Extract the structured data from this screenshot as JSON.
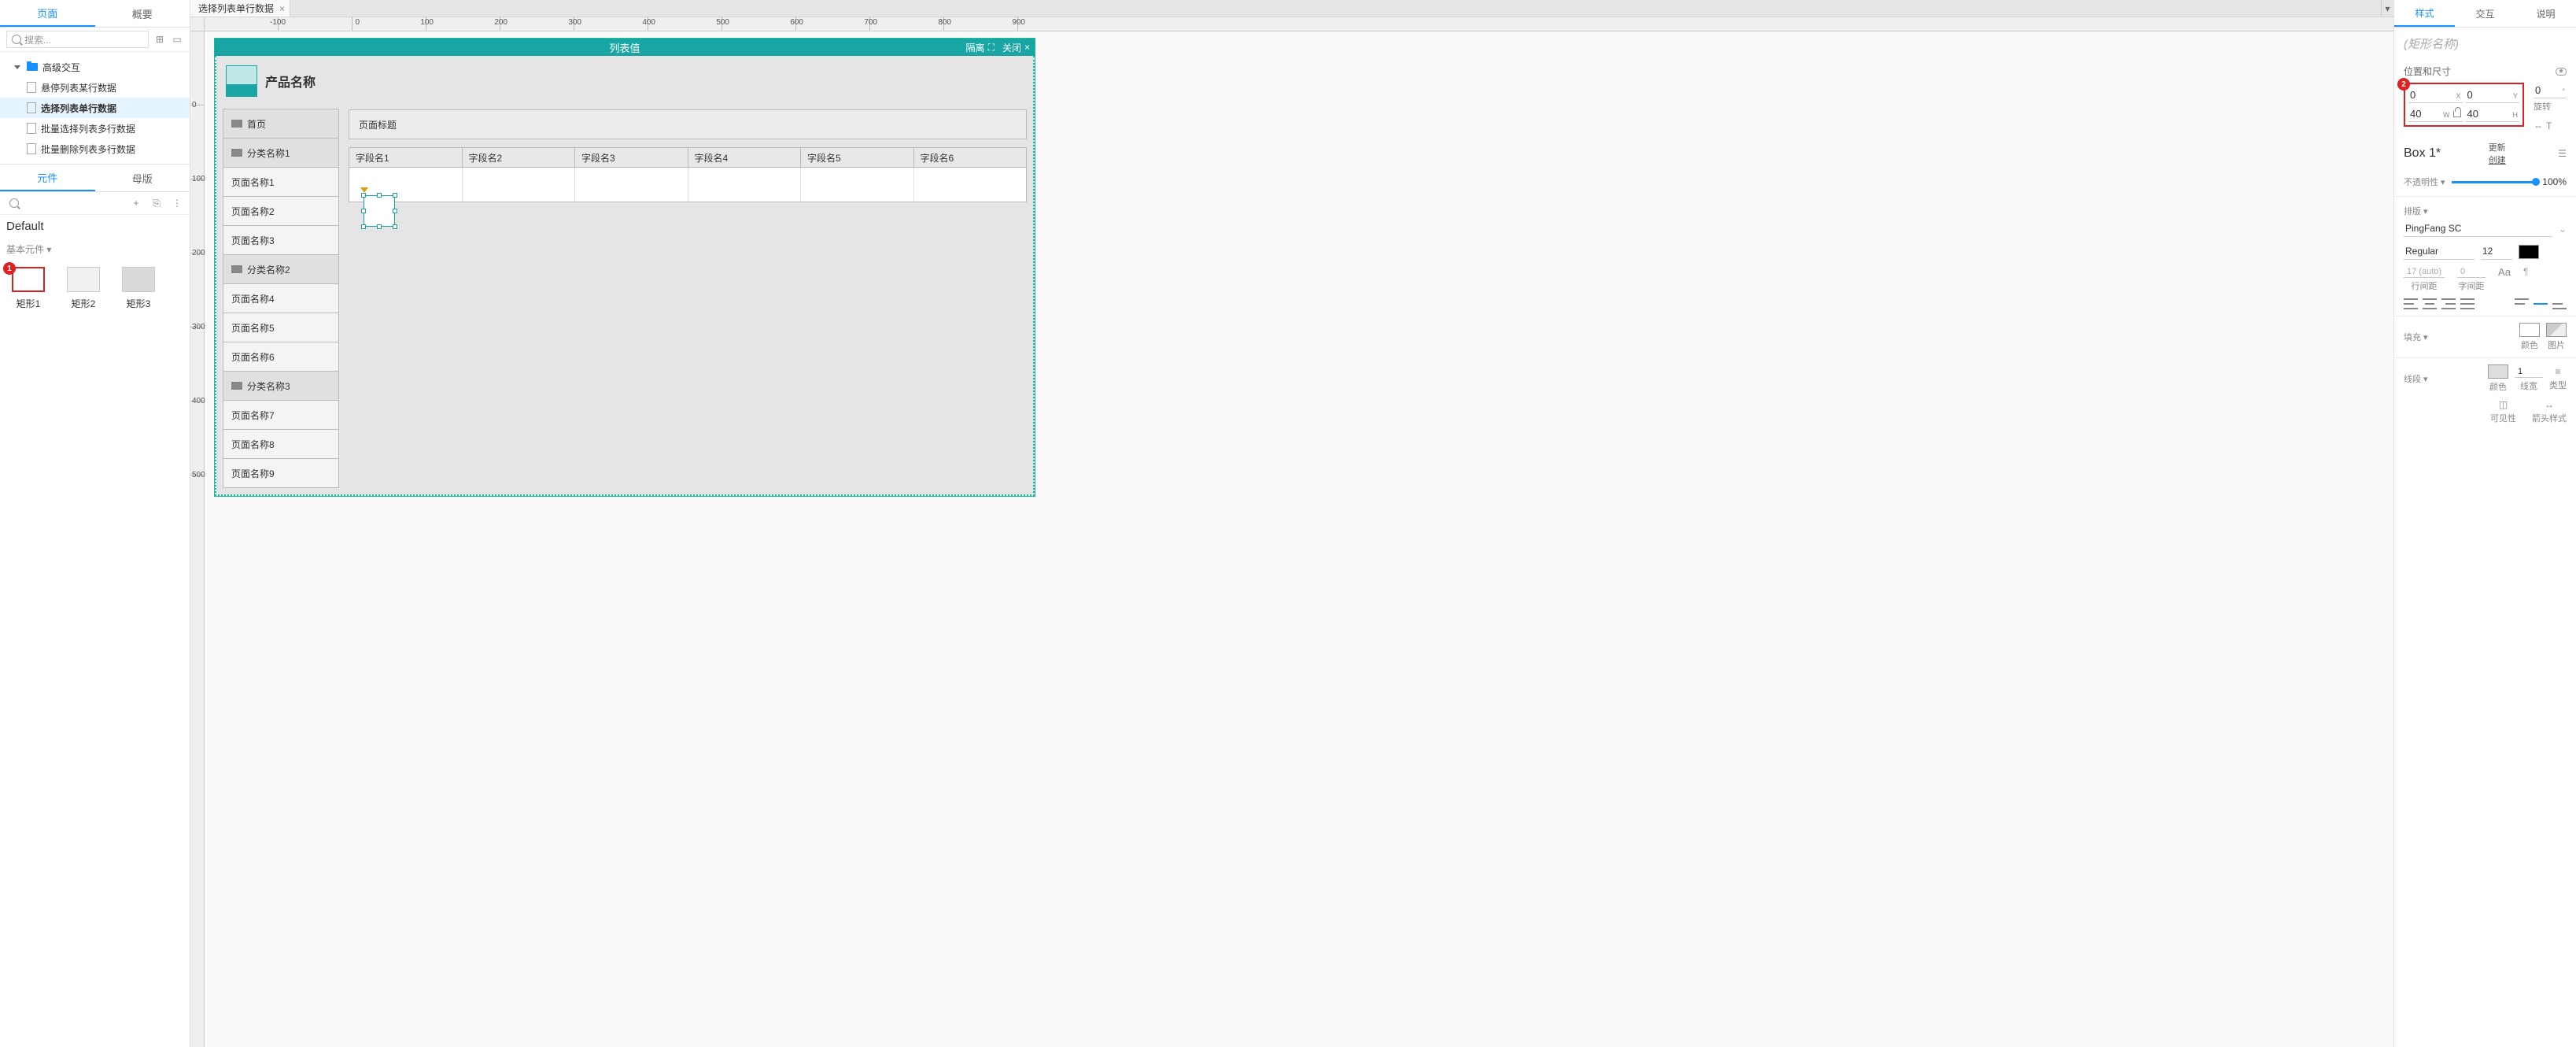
{
  "left": {
    "tabs": {
      "page": "页面",
      "outline": "概要"
    },
    "search_placeholder": "搜索...",
    "tree": {
      "folder": "高级交互",
      "pages": [
        "悬停列表某行数据",
        "选择列表单行数据",
        "批量选择列表多行数据",
        "批量删除列表多行数据"
      ],
      "active_index": 1
    },
    "lib_tabs": {
      "widgets": "元件",
      "masters": "母版"
    },
    "lib_name": "Default",
    "lib_section": "基本元件 ▾",
    "shapes": [
      "矩形1",
      "矩形2",
      "矩形3"
    ]
  },
  "tabbar": {
    "file_tab": "选择列表单行数据"
  },
  "ruler_h": [
    "-100",
    "0",
    "100",
    "200",
    "300",
    "400",
    "500",
    "600",
    "700",
    "800",
    "900"
  ],
  "ruler_v": [
    "0",
    "100",
    "200",
    "300",
    "400",
    "500"
  ],
  "artboard": {
    "title": "列表值",
    "isolate": "隔离",
    "close": "关闭",
    "product_name": "产品名称",
    "nav": [
      {
        "label": "首页",
        "cat": true
      },
      {
        "label": "分类名称1",
        "cat": true
      },
      {
        "label": "页面名称1"
      },
      {
        "label": "页面名称2"
      },
      {
        "label": "页面名称3"
      },
      {
        "label": "分类名称2",
        "cat": true
      },
      {
        "label": "页面名称4"
      },
      {
        "label": "页面名称5"
      },
      {
        "label": "页面名称6"
      },
      {
        "label": "分类名称3",
        "cat": true
      },
      {
        "label": "页面名称7"
      },
      {
        "label": "页面名称8"
      },
      {
        "label": "页面名称9"
      }
    ],
    "page_title": "页面标题",
    "columns": [
      "字段名1",
      "字段名2",
      "字段名3",
      "字段名4",
      "字段名5",
      "字段名6"
    ]
  },
  "right": {
    "tabs": {
      "style": "样式",
      "interact": "交互",
      "notes": "说明"
    },
    "shape_name_placeholder": "(矩形名称)",
    "pos_section": "位置和尺寸",
    "x": "0",
    "y": "0",
    "w": "40",
    "h": "40",
    "rot": "0",
    "rot_unit": "°",
    "rot_label": "旋转",
    "x_lbl": "X",
    "y_lbl": "Y",
    "w_lbl": "W",
    "h_lbl": "H",
    "component": "Box 1*",
    "update": "更新",
    "create": "创建",
    "opacity_label": "不透明性 ▾",
    "opacity": "100%",
    "typo_label": "排版 ▾",
    "font_family": "PingFang SC",
    "font_weight": "Regular",
    "font_size": "12",
    "line_h": "17 (auto)",
    "line_h_lbl": "行间距",
    "letter": "0",
    "letter_lbl": "字间距",
    "aa": "Aa",
    "fill_label": "填充 ▾",
    "fill_color_lbl": "颜色",
    "fill_img_lbl": "图片",
    "stroke_label": "线段 ▾",
    "stroke_color_lbl": "颜色",
    "stroke_w": "1",
    "stroke_w_lbl": "线宽",
    "stroke_type_lbl": "类型",
    "vis_lbl": "可见性",
    "arrow_lbl": "箭头样式"
  },
  "badges": {
    "one": "1",
    "two": "2"
  }
}
